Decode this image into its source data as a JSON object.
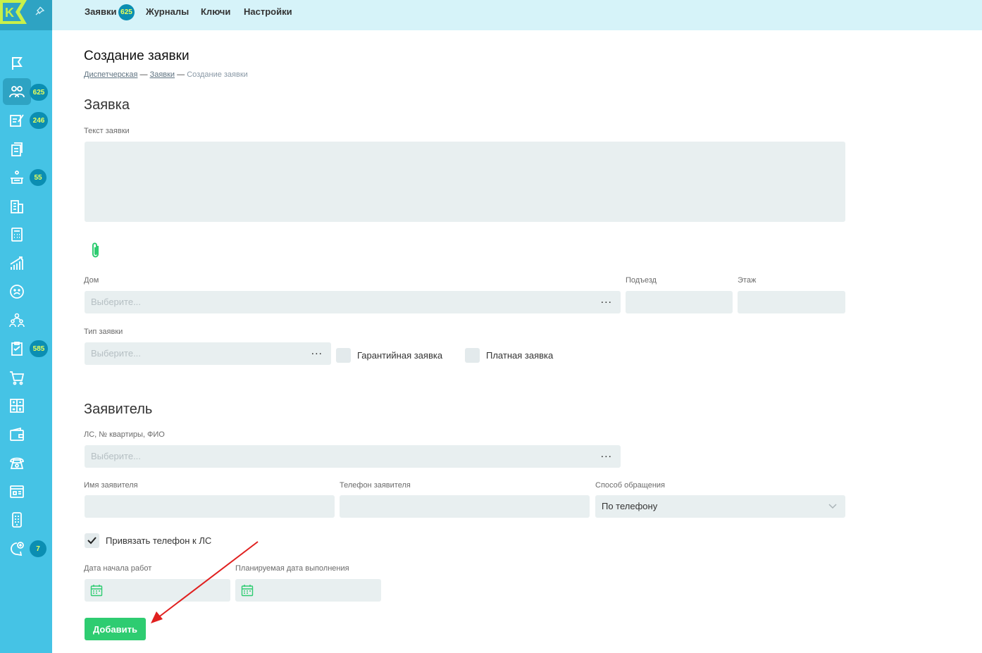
{
  "topnav": {
    "items": [
      {
        "label": "Заявки",
        "badge": "625"
      },
      {
        "label": "Журналы"
      },
      {
        "label": "Ключи"
      },
      {
        "label": "Настройки"
      }
    ]
  },
  "sidebar": {
    "logo_letter": "K",
    "badges": {
      "requests": "625",
      "tasks": "246",
      "services": "55",
      "checklist": "585",
      "chat": "7"
    },
    "icons": [
      "flag-icon",
      "people-icon",
      "edit-note-icon",
      "documents-icon",
      "service-icon",
      "building-icon",
      "calculator-icon",
      "chart-icon",
      "sad-face-icon",
      "team-icon",
      "checklist-icon",
      "cart-icon",
      "calc-grid-icon",
      "wallet-icon",
      "phone-icon",
      "dashboard-icon",
      "mobile-icon",
      "chat-add-icon"
    ]
  },
  "page": {
    "title": "Создание заявки",
    "breadcrumb": {
      "link1": "Диспетчерская",
      "sep": "—",
      "link2": "Заявки",
      "current": "Создание заявки"
    }
  },
  "request": {
    "section_title": "Заявка",
    "text_label": "Текст заявки",
    "house_label": "Дом",
    "house_placeholder": "Выберите...",
    "entrance_label": "Подъезд",
    "floor_label": "Этаж",
    "type_label": "Тип заявки",
    "type_placeholder": "Выберите...",
    "warranty_label": "Гарантийная заявка",
    "paid_label": "Платная заявка",
    "dots": "..."
  },
  "applicant": {
    "section_title": "Заявитель",
    "account_label": "ЛС, № квартиры, ФИО",
    "account_placeholder": "Выберите...",
    "name_label": "Имя заявителя",
    "phone_label": "Телефон заявителя",
    "method_label": "Способ обращения",
    "method_value": "По телефону",
    "bind_phone_label": "Привязать телефон к ЛС",
    "bind_phone_checked": true,
    "start_date_label": "Дата начала работ",
    "planned_date_label": "Планируемая дата выполнения"
  },
  "actions": {
    "submit_label": "Добавить"
  },
  "colors": {
    "sidebar": "#45c3e5",
    "topbar": "#d6f3f9",
    "accent": "#2ecc71",
    "badge": "#0b8eb2",
    "badge_text": "#e8ff5a",
    "annotation_arrow": "#e0201f"
  }
}
